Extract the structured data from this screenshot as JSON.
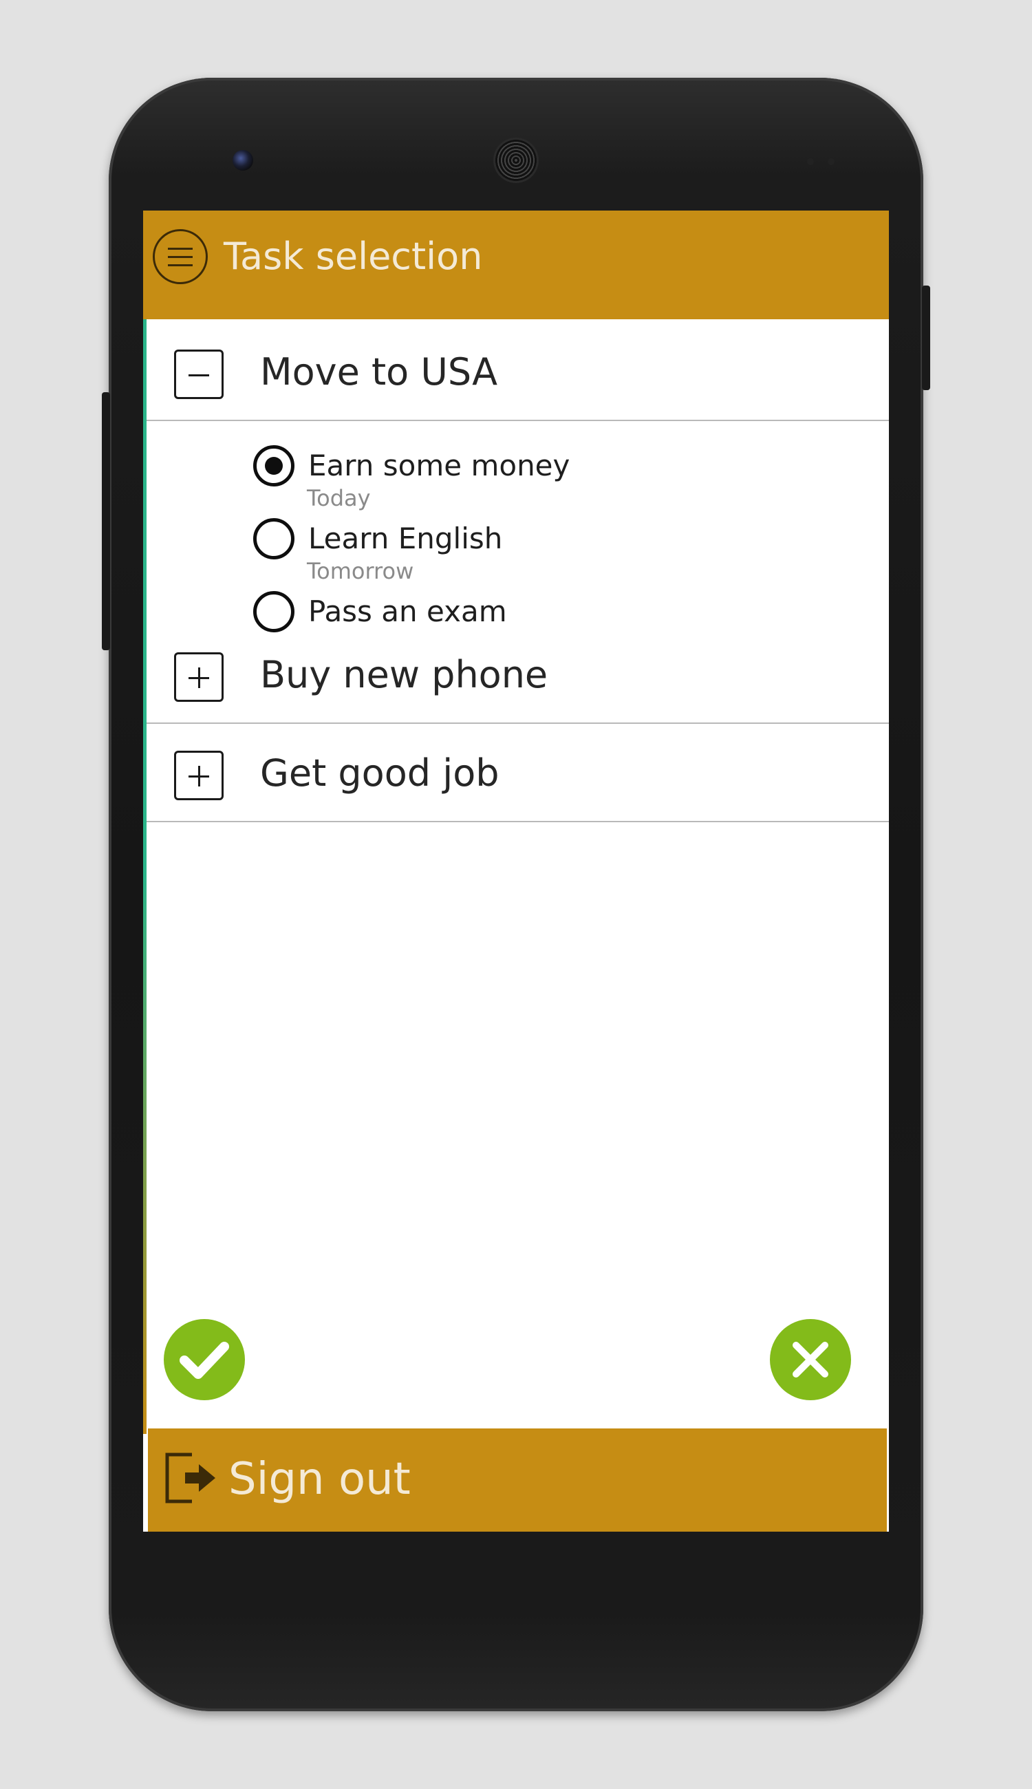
{
  "header": {
    "title": "Task selection",
    "menu_icon": "hamburger-menu-icon"
  },
  "tasks": [
    {
      "label": "Move to USA",
      "expanded": true,
      "subtasks": [
        {
          "label": "Earn some money",
          "date": "Today",
          "selected": true
        },
        {
          "label": "Learn English",
          "date": "Tomorrow",
          "selected": false
        },
        {
          "label": "Pass an exam",
          "date": "",
          "selected": false
        }
      ]
    },
    {
      "label": "Buy new phone",
      "expanded": false
    },
    {
      "label": "Get good job",
      "expanded": false
    }
  ],
  "actions": {
    "confirm_icon": "checkmark-icon",
    "cancel_icon": "close-icon"
  },
  "footer": {
    "signout_label": "Sign out",
    "signout_icon": "sign-out-icon"
  },
  "colors": {
    "brand": "#c68d14",
    "accent_green": "#83bb1a",
    "stripe_teal": "#2bb58a"
  }
}
